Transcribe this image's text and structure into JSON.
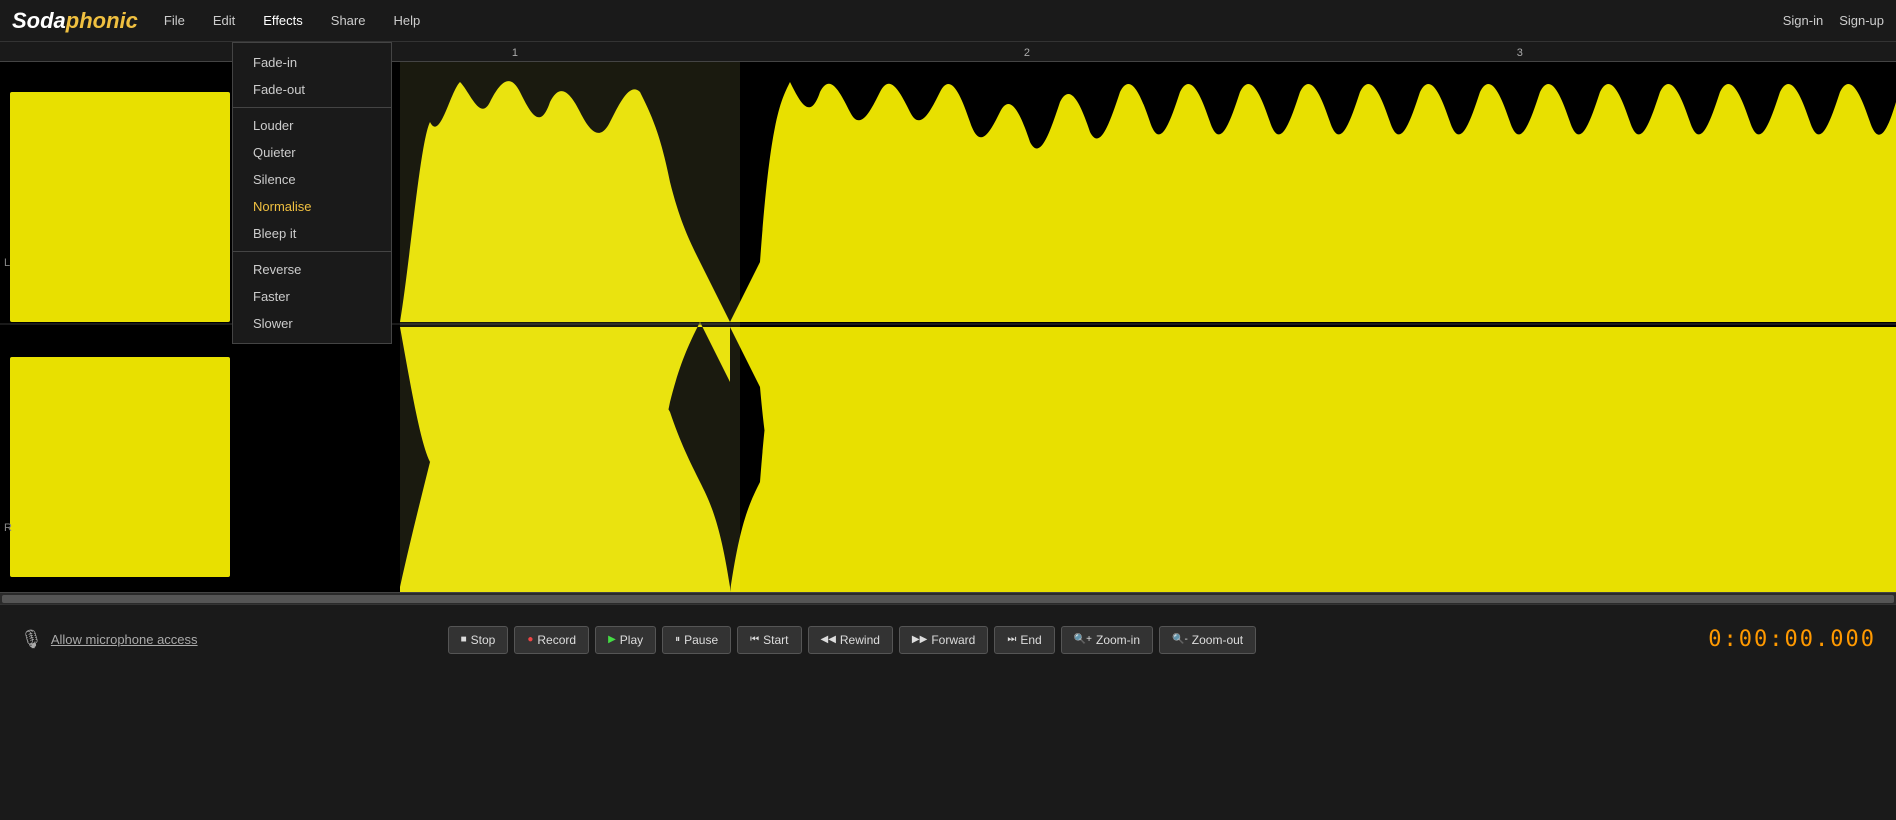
{
  "header": {
    "logo": "Sodaphonic",
    "nav": [
      {
        "id": "file",
        "label": "File"
      },
      {
        "id": "edit",
        "label": "Edit"
      },
      {
        "id": "effects",
        "label": "Effects"
      },
      {
        "id": "share",
        "label": "Share"
      },
      {
        "id": "help",
        "label": "Help"
      }
    ],
    "auth": [
      {
        "id": "signin",
        "label": "Sign-in"
      },
      {
        "id": "signup",
        "label": "Sign-up"
      }
    ]
  },
  "effects_menu": {
    "items": [
      {
        "id": "fade-in",
        "label": "Fade-in",
        "group": 1
      },
      {
        "id": "fade-out",
        "label": "Fade-out",
        "group": 1
      },
      {
        "id": "louder",
        "label": "Louder",
        "group": 2
      },
      {
        "id": "quieter",
        "label": "Quieter",
        "group": 2
      },
      {
        "id": "silence",
        "label": "Silence",
        "group": 2
      },
      {
        "id": "normalise",
        "label": "Normalise",
        "group": 2,
        "highlighted": true
      },
      {
        "id": "bleep-it",
        "label": "Bleep it",
        "group": 2
      },
      {
        "id": "reverse",
        "label": "Reverse",
        "group": 3
      },
      {
        "id": "faster",
        "label": "Faster",
        "group": 3
      },
      {
        "id": "slower",
        "label": "Slower",
        "group": 3
      }
    ]
  },
  "ruler": {
    "ticks": [
      {
        "label": "1",
        "percent": 27
      },
      {
        "label": "2",
        "percent": 54
      },
      {
        "label": "3",
        "percent": 80
      }
    ]
  },
  "channels": {
    "L": "L",
    "R": "R"
  },
  "toolbar": {
    "mic_text": "Allow microphone access",
    "buttons": [
      {
        "id": "stop",
        "label": "Stop",
        "icon": "■"
      },
      {
        "id": "record",
        "label": "Record",
        "icon": "●"
      },
      {
        "id": "play",
        "label": "Play",
        "icon": "▶"
      },
      {
        "id": "pause",
        "label": "Pause",
        "icon": "⏸"
      },
      {
        "id": "start",
        "label": "Start",
        "icon": "⏮"
      },
      {
        "id": "rewind",
        "label": "Rewind",
        "icon": "◀◀"
      },
      {
        "id": "forward",
        "label": "Forward",
        "icon": "▶▶"
      },
      {
        "id": "end",
        "label": "End",
        "icon": "⏭"
      },
      {
        "id": "zoom-in",
        "label": "Zoom-in",
        "icon": "🔍"
      },
      {
        "id": "zoom-out",
        "label": "Zoom-out",
        "icon": "🔍"
      }
    ],
    "time": "0:00:00.000"
  }
}
